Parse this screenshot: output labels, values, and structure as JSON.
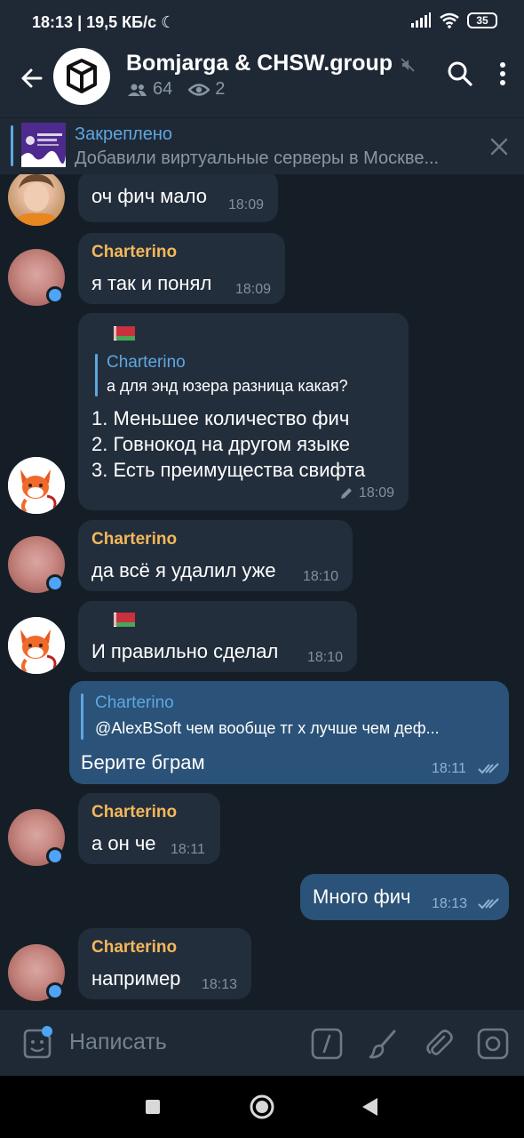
{
  "status_bar": {
    "time": "18:13",
    "net_speed": "19,5 КБ/с",
    "battery": "35"
  },
  "header": {
    "title": "Bomjarga & CHSW.group",
    "members": "64",
    "viewers": "2"
  },
  "pinned": {
    "label": "Закреплено",
    "text": "Добавили виртуальные серверы в Москве..."
  },
  "messages": [
    {
      "text": "оч фич мало",
      "time": "18:09"
    },
    {
      "sender": "Charterino",
      "text": "я так и понял",
      "time": "18:09"
    },
    {
      "reply_name": "Charterino",
      "reply_text": "а для энд юзера разница какая?",
      "lines": [
        "1. Меньшее количество фич",
        "2. Говнокод на другом языке",
        "3. Есть преимущества свифта"
      ],
      "time": "18:09"
    },
    {
      "sender": "Charterino",
      "text": "да всё я удалил уже",
      "time": "18:10"
    },
    {
      "text": "И правильно сделал",
      "time": "18:10"
    },
    {
      "reply_name": "Charterino",
      "reply_text": "@AlexBSoft чем вообще тг х лучше чем деф...",
      "text": "Берите бграм",
      "time": "18:11"
    },
    {
      "sender": "Charterino",
      "text": "а он че",
      "time": "18:11"
    },
    {
      "text": "Много фич",
      "time": "18:13"
    },
    {
      "sender": "Charterino",
      "text": "например",
      "time": "18:13"
    }
  ],
  "input": {
    "placeholder": "Написать"
  },
  "colors": {
    "background": "#151e27",
    "header": "#1f2936",
    "bubble_in": "#232e3c",
    "bubble_out": "#2b5278",
    "accent": "#5ea7e0",
    "sender_name": "#f5b85a"
  }
}
